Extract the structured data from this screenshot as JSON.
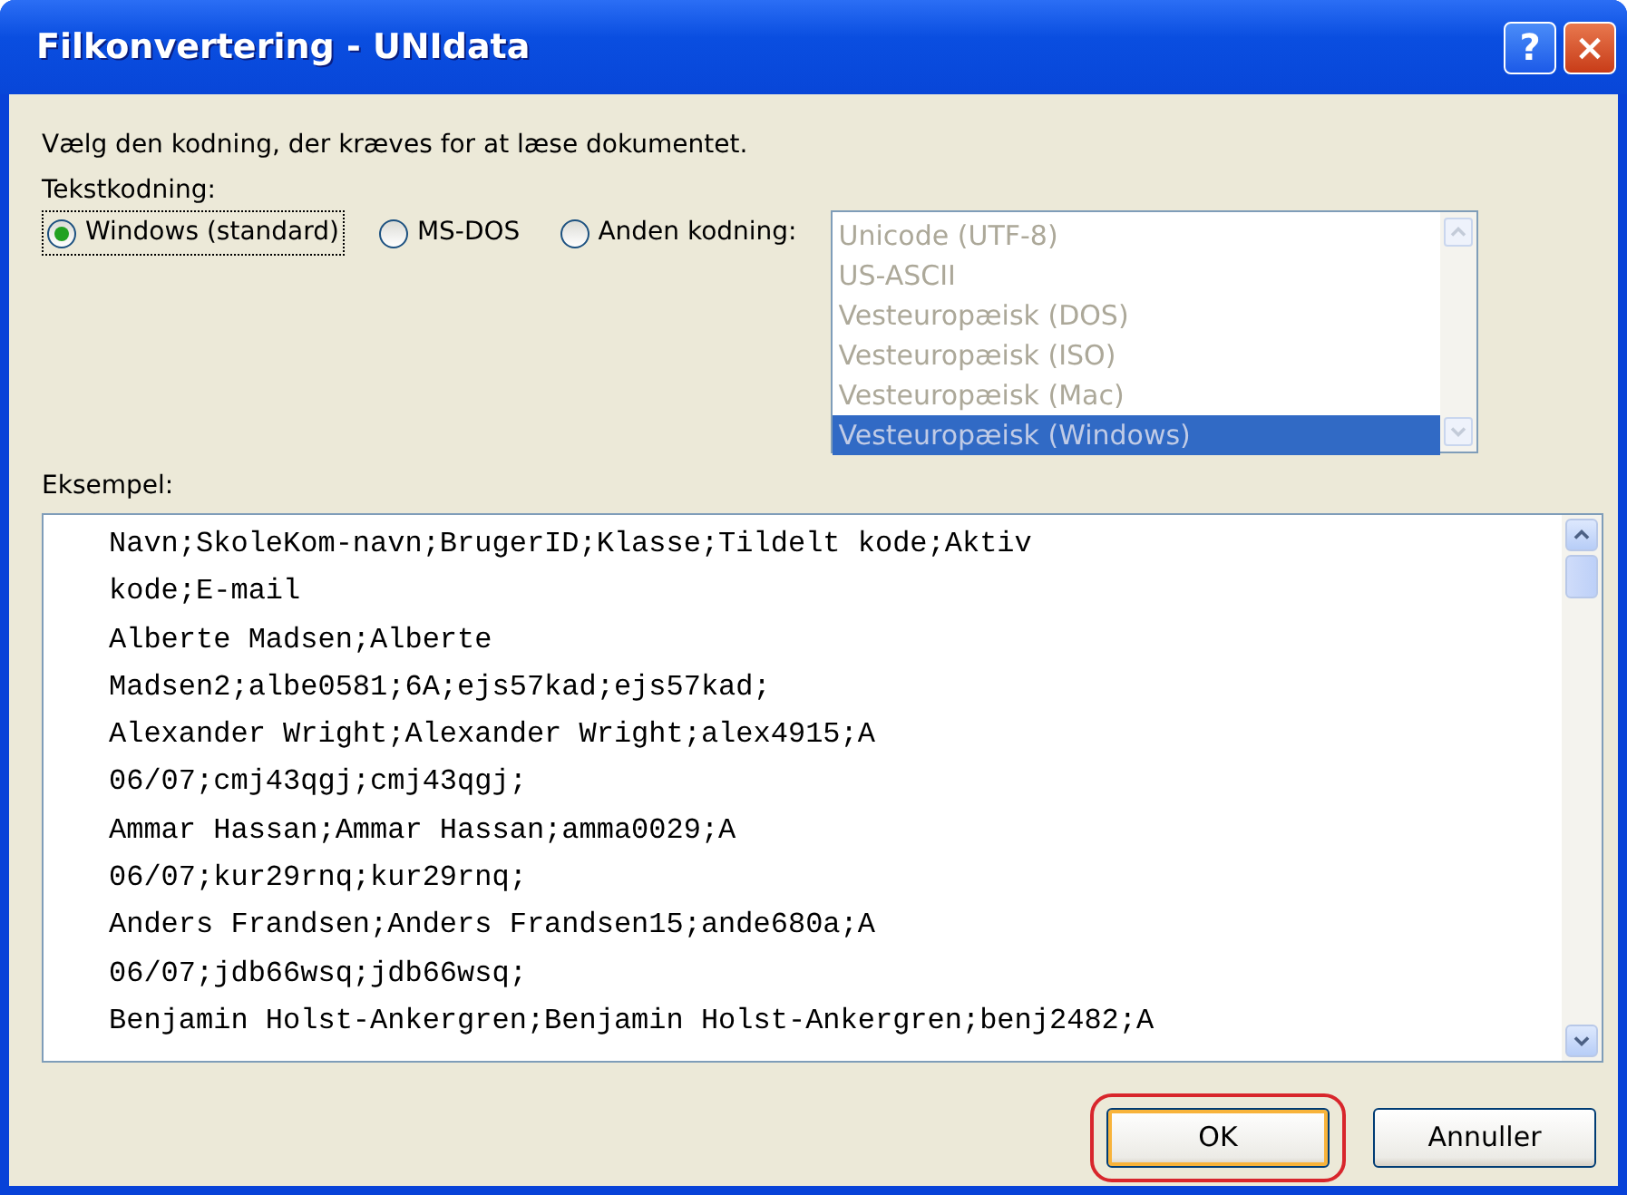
{
  "window": {
    "title": "Filkonvertering - UNIdata",
    "help_button": "?",
    "close_button": "×"
  },
  "instruction": "Vælg den kodning, der kræves for at læse dokumentet.",
  "encoding_label": "Tekstkodning:",
  "encoding_options": [
    {
      "label": "Windows (standard)",
      "selected": true
    },
    {
      "label": "MS-DOS",
      "selected": false
    },
    {
      "label": "Anden kodning:",
      "selected": false
    }
  ],
  "encoding_list": {
    "disabled": true,
    "items": [
      {
        "label": "Unicode (UTF-8)",
        "selected": false
      },
      {
        "label": "US-ASCII",
        "selected": false
      },
      {
        "label": "Vesteuropæisk (DOS)",
        "selected": false
      },
      {
        "label": "Vesteuropæisk (ISO)",
        "selected": false
      },
      {
        "label": "Vesteuropæisk (Mac)",
        "selected": false
      },
      {
        "label": "Vesteuropæisk (Windows)",
        "selected": true
      }
    ]
  },
  "preview_label": "Eksempel:",
  "preview_lines": [
    "Navn;SkoleKom-navn;BrugerID;Klasse;Tildelt kode;Aktiv",
    "kode;E-mail",
    "Alberte Madsen;Alberte",
    "Madsen2;albe0581;6A;ejs57kad;ejs57kad;",
    "Alexander Wright;Alexander Wright;alex4915;A",
    "06/07;cmj43qgj;cmj43qgj;",
    "Ammar Hassan;Ammar Hassan;amma0029;A",
    "06/07;kur29rnq;kur29rnq;",
    "Anders Frandsen;Anders Frandsen15;ande680a;A",
    "06/07;jdb66wsq;jdb66wsq;",
    "Benjamin Holst-Ankergren;Benjamin Holst-Ankergren;benj2482;A"
  ],
  "buttons": [
    {
      "label": "OK",
      "default": true,
      "highlighted": true
    },
    {
      "label": "Annuller",
      "default": false,
      "highlighted": false
    }
  ]
}
